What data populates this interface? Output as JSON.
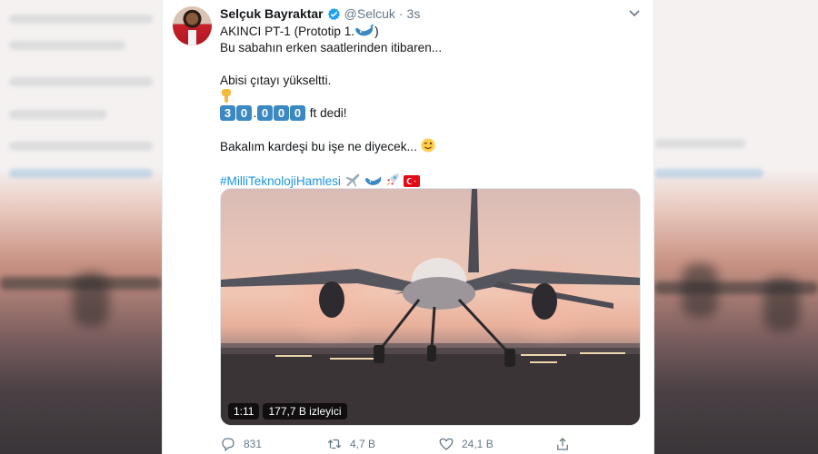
{
  "tweet": {
    "author_name": "Selçuk Bayraktar",
    "handle": "@Selcuk",
    "separator": "·",
    "time": "3s",
    "lines": {
      "l1": "AKINCI PT-1 (Prototip 1.",
      "l1_end": ")",
      "l2": "Bu sabahın erken saatlerinden itibaren...",
      "l3": "Abisi çıtayı yükseltti.",
      "keys": [
        "3",
        "0",
        "0",
        "0",
        "0"
      ],
      "key_separator": ".",
      "l4_end": " ft dedi!",
      "l5": "Bakalım kardeşi bu işe ne diyecek...",
      "hashtag": "#MilliTeknolojiHamlesi"
    },
    "icons": {
      "verified": "verified-badge-icon",
      "caret": "chevron-down-icon",
      "whale": "whale-emoji",
      "point_down": "pointing-down-emoji",
      "wink": "winking-face-emoji",
      "plane": "airplane-emoji",
      "rocket": "rocket-emoji",
      "flag": "turkey-flag-emoji"
    },
    "media": {
      "duration": "1:11",
      "views": "177,7 B izleyici"
    },
    "actions": {
      "replies": "831",
      "retweets": "4,7 B",
      "likes": "24,1 B"
    }
  },
  "colors": {
    "link": "#1b95e0",
    "verified": "#1da1f2",
    "muted": "#657786",
    "text": "#14171a",
    "key": "#3b88c3"
  }
}
